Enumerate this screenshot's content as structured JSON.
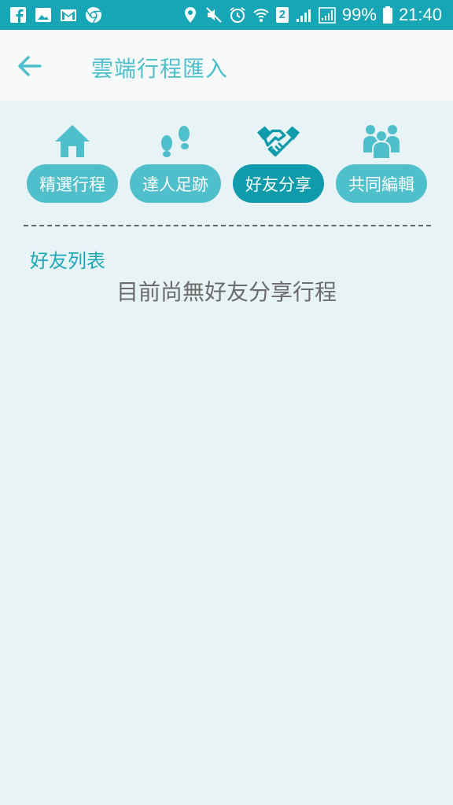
{
  "status_bar": {
    "icons_left": [
      "facebook-icon",
      "image-icon",
      "gmail-icon",
      "chrome-icon"
    ],
    "icons_right": [
      "location-icon",
      "mute-icon",
      "alarm-icon",
      "wifi-icon",
      "sim2-icon",
      "signal-icon",
      "signal-icon",
      "battery-icon"
    ],
    "sim_label": "2",
    "battery": "99%",
    "time": "21:40"
  },
  "header": {
    "title": "雲端行程匯入",
    "back_icon": "arrow-left-icon"
  },
  "categories": [
    {
      "label": "精選行程",
      "icon": "home-icon",
      "active": false
    },
    {
      "label": "達人足跡",
      "icon": "footprints-icon",
      "active": false
    },
    {
      "label": "好友分享",
      "icon": "handshake-icon",
      "active": true
    },
    {
      "label": "共同編輯",
      "icon": "group-icon",
      "active": false
    }
  ],
  "friends": {
    "section_title": "好友列表",
    "empty_message": "目前尚無好友分享行程"
  },
  "colors": {
    "status_bar": "#17a6b6",
    "accent": "#4fbfcc",
    "active": "#0f9bab",
    "background": "#e8f3f5"
  }
}
